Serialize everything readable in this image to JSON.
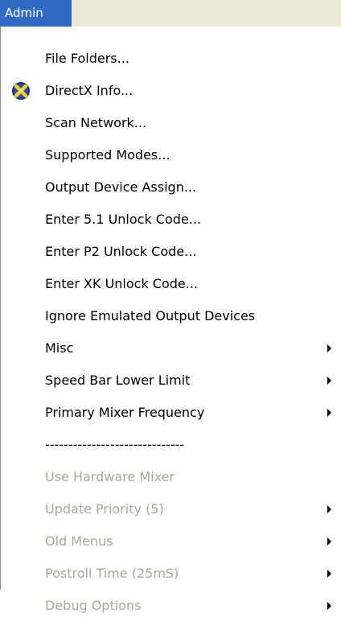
{
  "menubar": {
    "title": "Admin"
  },
  "icons": {
    "directx": "directx-icon",
    "submenu": "submenu-arrow-icon"
  },
  "colors": {
    "highlight": "#316ac5",
    "disabled_text": "#aca899",
    "menubar_bg": "#ece9d8"
  },
  "menu": {
    "items": [
      {
        "label": "File Folders..."
      },
      {
        "label": "DirectX Info..."
      },
      {
        "label": "Scan Network..."
      },
      {
        "label": "Supported Modes..."
      },
      {
        "label": "Output Device Assign..."
      },
      {
        "label": "Enter 5.1 Unlock Code..."
      },
      {
        "label": "Enter P2 Unlock Code..."
      },
      {
        "label": "Enter XK Unlock Code..."
      },
      {
        "label": "Ignore Emulated Output Devices"
      },
      {
        "label": "Misc"
      },
      {
        "label": "Speed Bar Lower Limit"
      },
      {
        "label": "Primary Mixer Frequency"
      },
      {
        "label": "------------------------------"
      },
      {
        "label": "Use Hardware Mixer"
      },
      {
        "label": "Update Priority (5)"
      },
      {
        "label": "Old Menus"
      },
      {
        "label": "Postroll Time (25mS)"
      },
      {
        "label": "Debug Options"
      }
    ]
  }
}
